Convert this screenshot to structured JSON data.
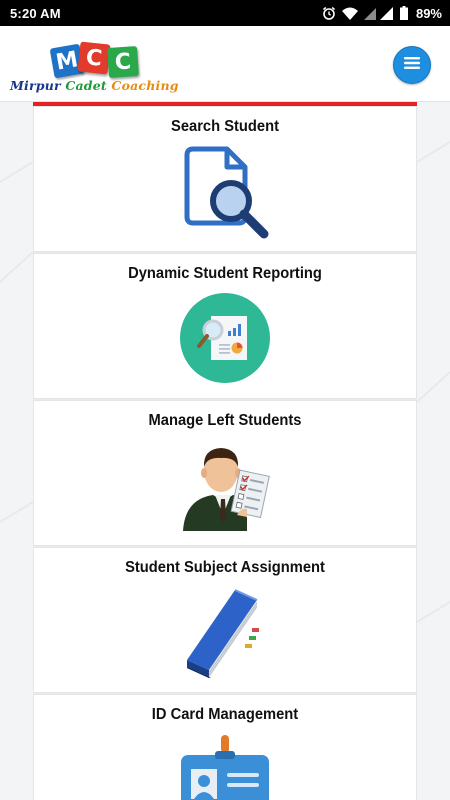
{
  "status_bar": {
    "time": "5:20 AM",
    "battery": "89%",
    "icons": [
      "alarm-icon",
      "wifi-icon",
      "signal-icon",
      "battery-icon"
    ]
  },
  "header": {
    "logo": {
      "letters": [
        "M",
        "C",
        "C"
      ],
      "name_part1": "Mirpur ",
      "name_part2": "Cadet ",
      "name_part3": "Coaching"
    },
    "menu_icon": "hamburger-menu-icon"
  },
  "colors": {
    "accent_red": "#e52222",
    "menu_blue": "#1e8ee0",
    "logo_blue": "#1e73c8",
    "logo_red": "#e23b2b",
    "logo_green": "#2aa84a"
  },
  "menu_items": [
    {
      "label": "Search Student",
      "icon": "search-document-icon"
    },
    {
      "label": "Dynamic Student Reporting",
      "icon": "report-analytics-icon"
    },
    {
      "label": "Manage Left Students",
      "icon": "student-checklist-icon"
    },
    {
      "label": "Student Subject Assignment",
      "icon": "book-icon"
    },
    {
      "label": "ID Card Management",
      "icon": "id-card-icon"
    }
  ]
}
